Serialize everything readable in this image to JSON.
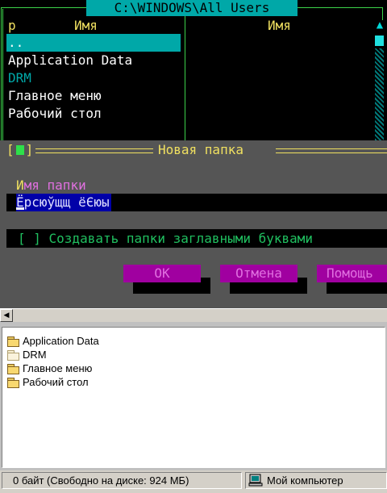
{
  "far_panel": {
    "path_title": " C:\\WINDOWS\\All Users ",
    "left_header_prefix": "р",
    "left_header_name": "Имя",
    "right_header_name": "Имя",
    "files": [
      {
        "name": ".."
      },
      {
        "name": "Application Data"
      },
      {
        "name": "DRM"
      },
      {
        "name": "Главное меню"
      },
      {
        "name": "Рабочий стол"
      }
    ]
  },
  "dialog": {
    "close_left": "[",
    "close_right": "]",
    "title": "Новая папка",
    "name_label_hotkey": "И",
    "name_label_rest": "мя папки",
    "name_value": "Ёрсюўщщ ёЄюы",
    "caps_option": "[ ] Создавать папки заглавными буквами",
    "ok_label": "OK",
    "cancel_label": "Отмена",
    "help_label": "Помощь"
  },
  "explorer": {
    "items": [
      {
        "name": "Application Data",
        "icon": "folder-icon"
      },
      {
        "name": "DRM",
        "icon": "folder-icon"
      },
      {
        "name": "Главное меню",
        "icon": "folder-icon"
      },
      {
        "name": "Рабочий стол",
        "icon": "folder-icon"
      }
    ]
  },
  "statusbar": {
    "size_text": "0 байт (Свободно на диске: 924 МБ)",
    "location_text": "Мой компьютер",
    "location_icon": "my-computer-icon"
  },
  "colors": {
    "panel_bg": "#000000",
    "panel_border": "#3cd24a",
    "cursor_teal": "#00a8a8",
    "dialog_bg": "#555555",
    "dialog_text": "#f0e060",
    "button_bg": "#a000a0"
  }
}
